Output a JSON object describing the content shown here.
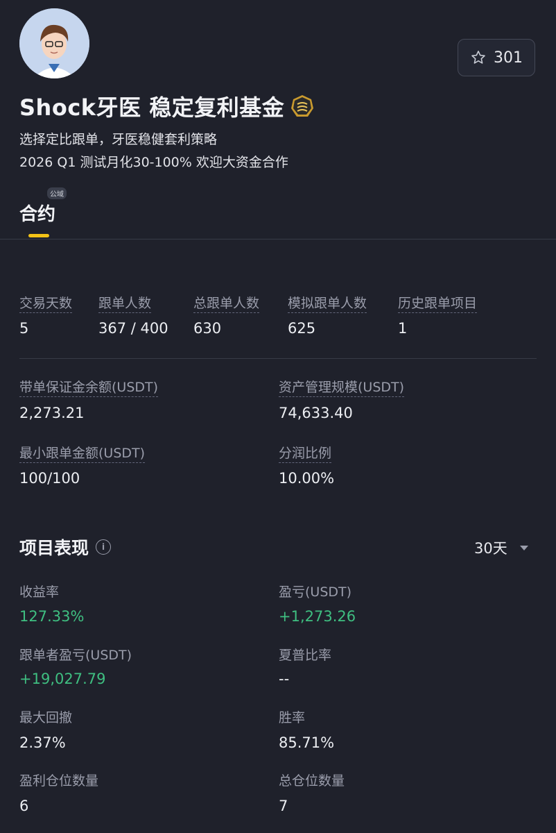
{
  "header": {
    "favorite_count": "301",
    "title": "Shock牙医 稳定复利基金",
    "description_line1": "选择定比跟单，牙医稳健套利策略",
    "description_line2": "2026 Q1 测试月化30-100% 欢迎大资金合作",
    "colors": {
      "background": "#1f212b",
      "accent": "#f3c317",
      "positive": "#3fbf81"
    }
  },
  "tabs": {
    "badge": "公域",
    "active_tab": "合约"
  },
  "stats": {
    "trading_days_label": "交易天数",
    "trading_days_value": "5",
    "followers_label": "跟单人数",
    "followers_value": "367 / 400",
    "total_followers_label": "总跟单人数",
    "total_followers_value": "630",
    "sim_followers_label": "模拟跟单人数",
    "sim_followers_value": "625",
    "history_projects_label": "历史跟单项目",
    "history_projects_value": "1"
  },
  "funds": {
    "margin_balance_label": "带单保证金余额(USDT)",
    "margin_balance_value": "2,273.21",
    "aum_label": "资产管理规模(USDT)",
    "aum_value": "74,633.40",
    "min_amount_label": "最小跟单金额(USDT)",
    "min_amount_value": "100/100",
    "profit_share_label": "分润比例",
    "profit_share_value": "10.00%"
  },
  "performance": {
    "section_title": "项目表现",
    "period": "30天",
    "roi_label": "收益率",
    "roi_value": "127.33%",
    "pnl_label": "盈亏(USDT)",
    "pnl_value": "+1,273.26",
    "follower_pnl_label": "跟单者盈亏(USDT)",
    "follower_pnl_value": "+19,027.79",
    "sharpe_label": "夏普比率",
    "sharpe_value": "--",
    "max_drawdown_label": "最大回撤",
    "max_drawdown_value": "2.37%",
    "win_rate_label": "胜率",
    "win_rate_value": "85.71%",
    "profit_positions_label": "盈利仓位数量",
    "profit_positions_value": "6",
    "total_positions_label": "总仓位数量",
    "total_positions_value": "7"
  }
}
